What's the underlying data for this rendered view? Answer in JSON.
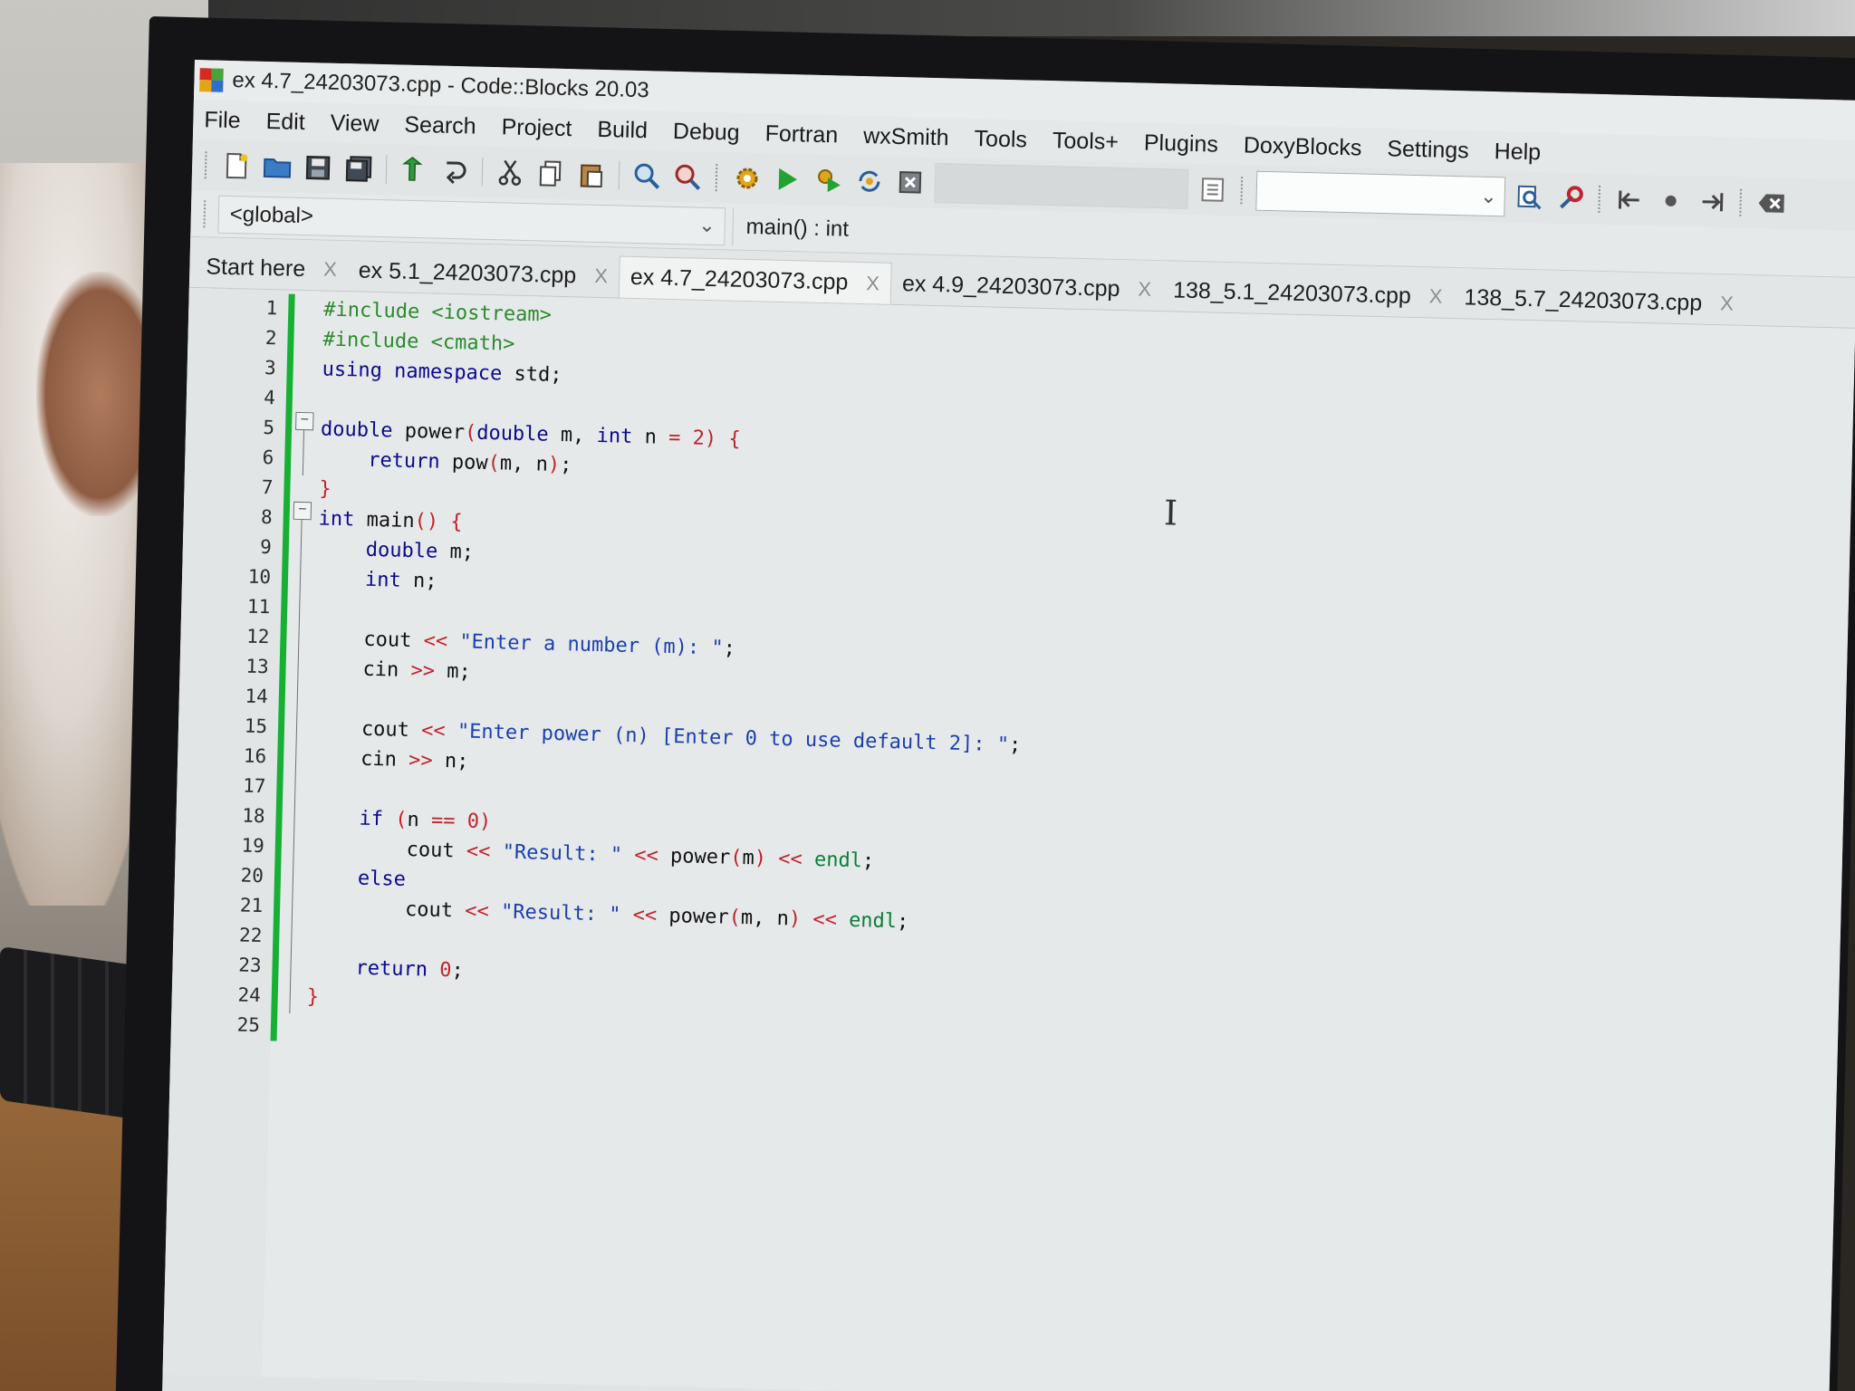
{
  "window": {
    "title": "ex 4.7_24203073.cpp - Code::Blocks 20.03"
  },
  "menu": [
    "File",
    "Edit",
    "View",
    "Search",
    "Project",
    "Build",
    "Debug",
    "Fortran",
    "wxSmith",
    "Tools",
    "Tools+",
    "Plugins",
    "DoxyBlocks",
    "Settings",
    "Help"
  ],
  "scope": {
    "value": "<global>",
    "function": "main() : int"
  },
  "tabs": [
    {
      "label": "Start here",
      "close": "X"
    },
    {
      "label": "ex 5.1_24203073.cpp",
      "close": "X"
    },
    {
      "label": "ex 4.7_24203073.cpp",
      "close": "X"
    },
    {
      "label": "ex 4.9_24203073.cpp",
      "close": "X"
    },
    {
      "label": "138_5.1_24203073.cpp",
      "close": "X"
    },
    {
      "label": "138_5.7_24203073.cpp",
      "close": "X"
    }
  ],
  "editor": {
    "line_numbers": [
      "1",
      "2",
      "3",
      "4",
      "5",
      "6",
      "7",
      "8",
      "9",
      "10",
      "11",
      "12",
      "13",
      "14",
      "15",
      "16",
      "17",
      "18",
      "19",
      "20",
      "21",
      "22",
      "23",
      "24",
      "25"
    ],
    "lines": [
      "#include <iostream>",
      "#include <cmath>",
      "using namespace std;",
      "",
      "double power(double m, int n = 2) {",
      "    return pow(m, n);",
      "}",
      "int main() {",
      "    double m;",
      "    int n;",
      "",
      "    cout << \"Enter a number (m): \";",
      "    cin >> m;",
      "",
      "    cout << \"Enter power (n) [Enter 0 to use default 2]: \";",
      "    cin >> n;",
      "",
      "    if (n == 0)",
      "        cout << \"Result: \" << power(m) << endl;",
      "    else",
      "        cout << \"Result: \" << power(m, n) << endl;",
      "",
      "    return 0;",
      "}",
      ""
    ]
  },
  "colors": {
    "change_bar": "#17b035",
    "keyword": "#0a0a8c",
    "string": "#1a3fb0",
    "preprocessor": "#2b8a2b",
    "number": "#c0232b"
  }
}
